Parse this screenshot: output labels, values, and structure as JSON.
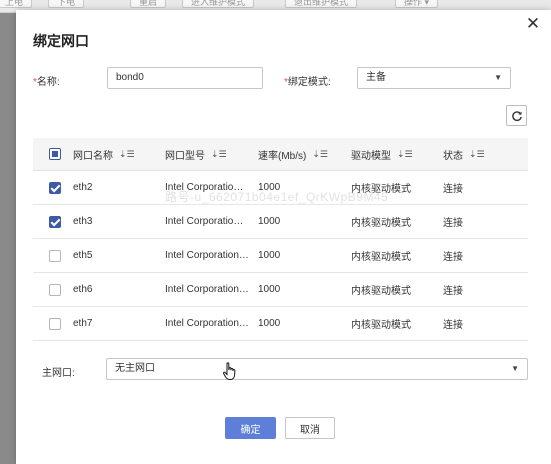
{
  "background": {
    "buttons": [
      "上电",
      "下电",
      "重启",
      "进入维护模式",
      "退出维护模式",
      "操作 ▾"
    ]
  },
  "dialog": {
    "title": "绑定网口",
    "close_icon": "close-icon",
    "name_label": "名称:",
    "name_value": "bond0",
    "mode_label": "绑定模式:",
    "mode_value": "主备",
    "refresh_icon": "refresh-icon",
    "required_mark": "*"
  },
  "table": {
    "columns": [
      "网口名称",
      "网口型号",
      "速率(Mb/s)",
      "驱动模型",
      "状态"
    ],
    "rows": [
      {
        "name": "eth2",
        "model": "Intel Corporatio…",
        "speed": "1000",
        "driver": "内核驱动模式",
        "status": "连接",
        "checked": true
      },
      {
        "name": "eth3",
        "model": "Intel Corporatio…",
        "speed": "1000",
        "driver": "内核驱动模式",
        "status": "连接",
        "checked": true
      },
      {
        "name": "eth5",
        "model": "Intel Corporation…",
        "speed": "1000",
        "driver": "内核驱动模式",
        "status": "连接",
        "checked": false
      },
      {
        "name": "eth6",
        "model": "Intel Corporation…",
        "speed": "1000",
        "driver": "内核驱动模式",
        "status": "连接",
        "checked": false
      },
      {
        "name": "eth7",
        "model": "Intel Corporation…",
        "speed": "1000",
        "driver": "内核驱动模式",
        "status": "连接",
        "checked": false
      }
    ]
  },
  "watermark": "路号-u_662071b04e1ef_QrKWpB9M45",
  "primary_nic": {
    "label": "主网口:",
    "value": "无主网口"
  },
  "footer": {
    "ok_label": "确定",
    "cancel_label": "取消"
  },
  "colors": {
    "primary": "#5d7fd7",
    "checkbox": "#3d5aa8",
    "required": "#e5474b"
  }
}
